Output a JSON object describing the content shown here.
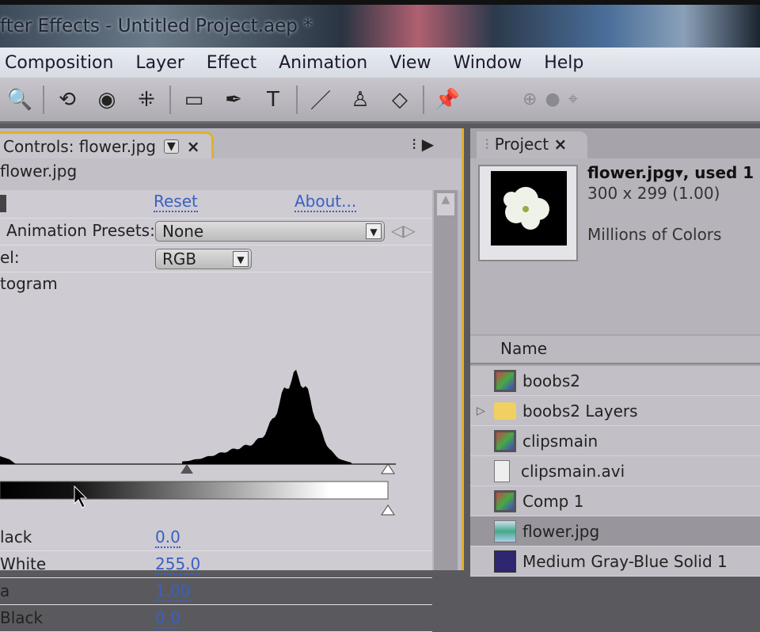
{
  "window": {
    "title": "fter Effects - Untitled Project.aep *"
  },
  "menu": [
    "Composition",
    "Layer",
    "Effect",
    "Animation",
    "View",
    "Window",
    "Help"
  ],
  "toolbar": {
    "tools": [
      {
        "icon": "zoom-icon",
        "glyph": "🔍"
      },
      {
        "icon": "rotate-icon",
        "glyph": "⟲"
      },
      {
        "icon": "orbit-camera-icon",
        "glyph": "◉"
      },
      {
        "icon": "pan-behind-icon",
        "glyph": "⁜"
      },
      {
        "icon": "rectangle-mask-icon",
        "glyph": "▭"
      },
      {
        "icon": "pen-icon",
        "glyph": "✒"
      },
      {
        "icon": "type-icon",
        "glyph": "T"
      },
      {
        "icon": "brush-icon",
        "glyph": "／"
      },
      {
        "icon": "clone-stamp-icon",
        "glyph": "♙"
      },
      {
        "icon": "eraser-icon",
        "glyph": "◇"
      },
      {
        "icon": "puppet-pin-icon",
        "glyph": "📌"
      }
    ]
  },
  "effect_controls": {
    "tab_label": "Controls: flower.jpg",
    "layer_name": "flower.jpg",
    "reset": "Reset",
    "about": "About...",
    "presets_label": "Animation Presets:",
    "presets_value": "None",
    "channel_label": "el:",
    "channel_value": "RGB",
    "histogram_label": "togram",
    "params": [
      {
        "label": "lack",
        "value": "0.0"
      },
      {
        "label": "White",
        "value": "255.0"
      },
      {
        "label": "a",
        "value": "1.00"
      },
      {
        "label": "Black",
        "value": "0.0"
      }
    ]
  },
  "project": {
    "tab_label": "Project",
    "selected": {
      "name": "flower.jpg▾, used 1",
      "dims": "300 x 299 (1.00)",
      "colors": "Millions of Colors"
    },
    "column": "Name",
    "items": [
      {
        "name": "boobs2",
        "type": "comp"
      },
      {
        "name": "boobs2 Layers",
        "type": "folder"
      },
      {
        "name": "clipsmain",
        "type": "comp"
      },
      {
        "name": "clipsmain.avi",
        "type": "avi"
      },
      {
        "name": "Comp 1",
        "type": "comp"
      },
      {
        "name": "flower.jpg",
        "type": "img",
        "selected": true
      },
      {
        "name": "Medium Gray-Blue Solid 1",
        "type": "solid"
      }
    ]
  }
}
